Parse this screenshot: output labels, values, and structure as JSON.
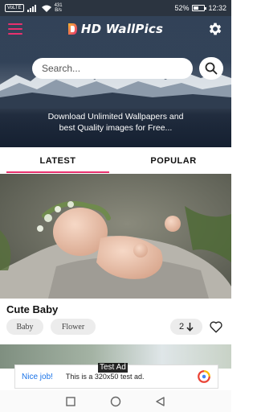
{
  "status_bar": {
    "carrier_chip": "VoLTE",
    "speed_value": "431",
    "speed_unit": "B/s",
    "battery_percent_text": "52%",
    "battery_level": 0.52,
    "time": "12:32"
  },
  "header": {
    "app_title": "HD WallPics",
    "menu_icon": "hamburger-menu-icon",
    "settings_icon": "gear-icon"
  },
  "search": {
    "placeholder": "Search...",
    "button_icon": "search-icon"
  },
  "hero": {
    "tagline_line1": "Download Unlimited Wallpapers and",
    "tagline_line2": "best Quality images for Free..."
  },
  "tabs": [
    {
      "label": "LATEST",
      "active": true
    },
    {
      "label": "POPULAR",
      "active": false
    }
  ],
  "card": {
    "title": "Cute Baby",
    "tags": [
      "Baby",
      "Flower"
    ],
    "download_count": "2",
    "download_icon": "arrow-down-icon",
    "favorite_icon": "heart-icon"
  },
  "ad": {
    "label": "Test Ad",
    "nice_text": "Nice job!",
    "body": "This is a 320x50 test ad."
  },
  "navigation": {
    "back_icon": "back-triangle-icon",
    "home_icon": "home-circle-icon",
    "recents_icon": "recents-square-icon"
  },
  "colors": {
    "accent": "#e8316e",
    "status_bar": "#2b3440",
    "chip_bg": "#ececec",
    "ad_link": "#1a73e8"
  }
}
